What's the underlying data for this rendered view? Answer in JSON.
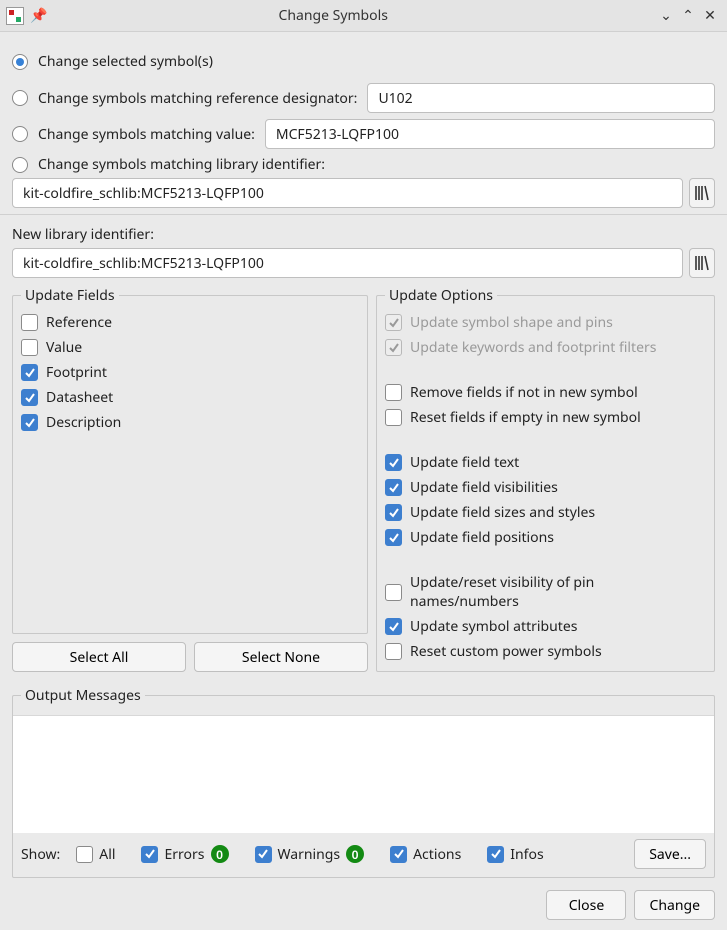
{
  "title": "Change Symbols",
  "scope": {
    "selected_label": "Change selected symbol(s)",
    "refdes_label": "Change symbols matching reference designator:",
    "refdes_value": "U102",
    "value_label": "Change symbols matching value:",
    "value_value": "MCF5213-LQFP100",
    "libid_label": "Change symbols matching library identifier:",
    "libid_value": "kit-coldfire_schlib:MCF5213-LQFP100"
  },
  "new_lib": {
    "label": "New library identifier:",
    "value": "kit-coldfire_schlib:MCF5213-LQFP100"
  },
  "update_fields": {
    "legend": "Update Fields",
    "items": [
      {
        "label": "Reference",
        "checked": false
      },
      {
        "label": "Value",
        "checked": false
      },
      {
        "label": "Footprint",
        "checked": true
      },
      {
        "label": "Datasheet",
        "checked": true
      },
      {
        "label": "Description",
        "checked": true
      }
    ],
    "select_all": "Select All",
    "select_none": "Select None"
  },
  "update_options": {
    "legend": "Update Options",
    "shape_label": "Update symbol shape and pins",
    "keywords_label": "Update keywords and footprint filters",
    "remove_fields_label": "Remove fields if not in new symbol",
    "reset_empty_label": "Reset fields if empty in new symbol",
    "update_text_label": "Update field text",
    "update_vis_label": "Update field visibilities",
    "update_size_label": "Update field sizes and styles",
    "update_pos_label": "Update field positions",
    "pin_names_label": "Update/reset visibility of pin names/numbers",
    "update_attrs_label": "Update symbol attributes",
    "reset_power_label": "Reset custom power symbols"
  },
  "output": {
    "legend": "Output Messages",
    "show_label": "Show:",
    "all_label": "All",
    "errors_label": "Errors",
    "errors_count": "0",
    "warnings_label": "Warnings",
    "warnings_count": "0",
    "actions_label": "Actions",
    "infos_label": "Infos",
    "save_label": "Save..."
  },
  "footer": {
    "close": "Close",
    "change": "Change"
  }
}
